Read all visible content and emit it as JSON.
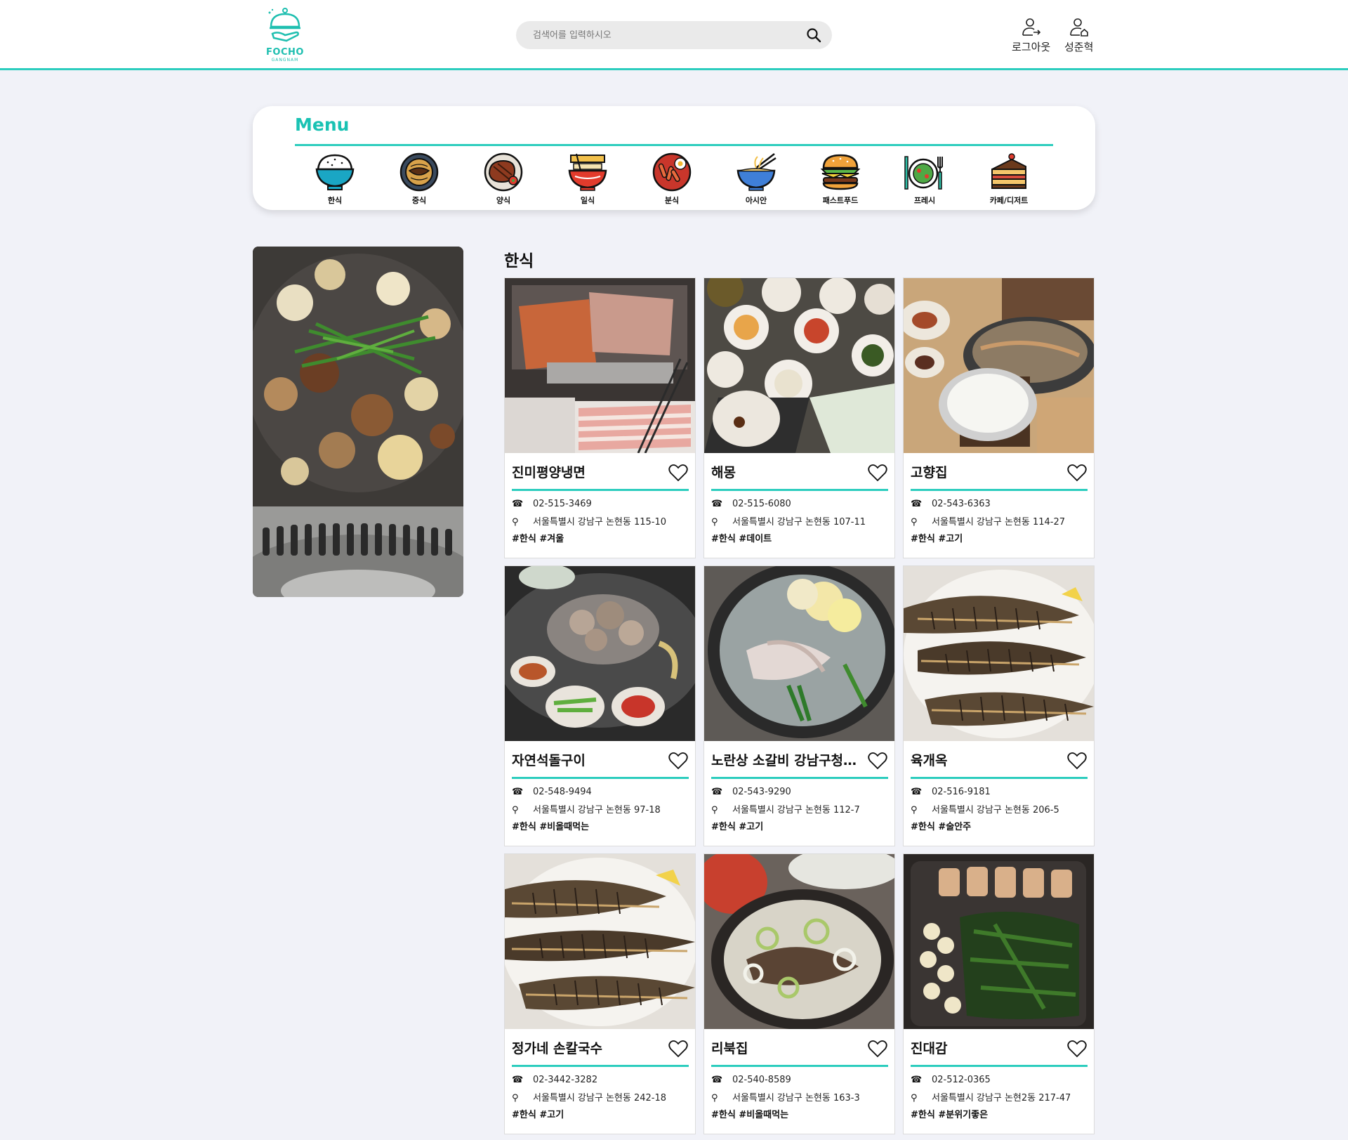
{
  "brand": {
    "name": "FOCHO",
    "sub": "GANGNAM",
    "accent": "#2dcdbe"
  },
  "search": {
    "placeholder": "검색어를 입력하시오",
    "icon": "search-icon"
  },
  "header_actions": {
    "logout": "로그아웃",
    "user": "성준혁"
  },
  "menu": {
    "title": "Menu",
    "categories": [
      {
        "label": "한식",
        "icon": "rice-bowl-icon"
      },
      {
        "label": "중식",
        "icon": "jajangmyeon-icon"
      },
      {
        "label": "양식",
        "icon": "steak-icon"
      },
      {
        "label": "일식",
        "icon": "ramen-icon"
      },
      {
        "label": "분식",
        "icon": "tteokbokki-icon"
      },
      {
        "label": "아시안",
        "icon": "noodle-bowl-icon"
      },
      {
        "label": "패스트푸드",
        "icon": "burger-icon"
      },
      {
        "label": "프레시",
        "icon": "salad-icon"
      },
      {
        "label": "카페/디저트",
        "icon": "cake-icon"
      }
    ]
  },
  "section": {
    "title": "한식"
  },
  "restaurants": [
    {
      "name": "진미평양냉면",
      "phone": "02-515-3469",
      "address": "서울특별시 강남구 논현동 115-10",
      "tags": "#한식 #겨울"
    },
    {
      "name": "해몽",
      "phone": "02-515-6080",
      "address": "서울특별시 강남구 논현동 107-11",
      "tags": "#한식 #데이트"
    },
    {
      "name": "고향집",
      "phone": "02-543-6363",
      "address": "서울특별시 강남구 논현동 114-27",
      "tags": "#한식 #고기"
    },
    {
      "name": "자연석돌구이",
      "phone": "02-548-9494",
      "address": "서울특별시 강남구 논현동 97-18",
      "tags": "#한식 #비올때먹는"
    },
    {
      "name": "노란상 소갈비 강남구청역점",
      "phone": "02-543-9290",
      "address": "서울특별시 강남구 논현동 112-7",
      "tags": "#한식 #고기"
    },
    {
      "name": "육개옥",
      "phone": "02-516-9181",
      "address": "서울특별시 강남구 논현동 206-5",
      "tags": "#한식 #술안주"
    },
    {
      "name": "정가네 손칼국수",
      "phone": "02-3442-3282",
      "address": "서울특별시 강남구 논현동 242-18",
      "tags": "#한식 #고기"
    },
    {
      "name": "리북집",
      "phone": "02-540-8589",
      "address": "서울특별시 강남구 논현동 163-3",
      "tags": "#한식 #비올때먹는"
    },
    {
      "name": "진대감",
      "phone": "02-512-0365",
      "address": "서울특별시 강남구 논현2동 217-47",
      "tags": "#한식 #분위기좋은"
    }
  ]
}
